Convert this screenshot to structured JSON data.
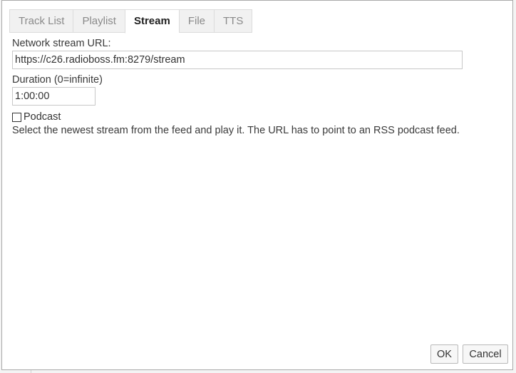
{
  "tabs": [
    {
      "label": "Track List",
      "active": false
    },
    {
      "label": "Playlist",
      "active": false
    },
    {
      "label": "Stream",
      "active": true
    },
    {
      "label": "File",
      "active": false
    },
    {
      "label": "TTS",
      "active": false
    }
  ],
  "stream": {
    "url_label": "Network stream URL:",
    "url_value": "https://c26.radioboss.fm:8279/stream",
    "duration_label": "Duration (0=infinite)",
    "duration_value": "1:00:00",
    "podcast_label": "Podcast",
    "podcast_checked": false,
    "description": "Select the newest stream from the feed and play it. The URL has to point to an RSS podcast feed."
  },
  "footer": {
    "ok_label": "OK",
    "cancel_label": "Cancel"
  }
}
